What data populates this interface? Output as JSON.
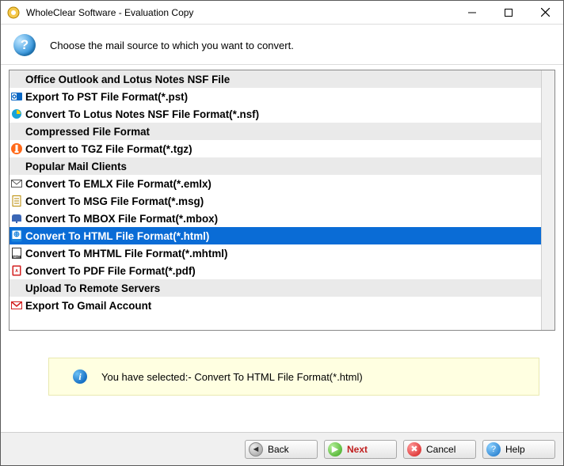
{
  "window": {
    "title": "WholeClear Software - Evaluation Copy"
  },
  "header": {
    "instruction": "Choose the mail source to which you want to convert."
  },
  "groups": [
    {
      "label": "Office Outlook and Lotus Notes NSF File"
    },
    {
      "label": "Compressed File Format"
    },
    {
      "label": "Popular Mail Clients"
    },
    {
      "label": "Upload To Remote Servers"
    }
  ],
  "items": {
    "pst": {
      "label": "Export To PST File Format(*.pst)"
    },
    "nsf": {
      "label": "Convert To Lotus Notes NSF File Format(*.nsf)"
    },
    "tgz": {
      "label": "Convert to TGZ File Format(*.tgz)"
    },
    "emlx": {
      "label": "Convert To EMLX File Format(*.emlx)"
    },
    "msg": {
      "label": "Convert To MSG File Format(*.msg)"
    },
    "mbox": {
      "label": "Convert To MBOX File Format(*.mbox)"
    },
    "html": {
      "label": "Convert To HTML File Format(*.html)"
    },
    "mhtml": {
      "label": "Convert To MHTML File Format(*.mhtml)"
    },
    "pdf": {
      "label": "Convert To PDF File Format(*.pdf)"
    },
    "gmail": {
      "label": "Export To Gmail Account"
    }
  },
  "selection_message": "You have selected:- Convert To HTML File Format(*.html)",
  "buttons": {
    "back": "Back",
    "next": "Next",
    "cancel": "Cancel",
    "help": "Help"
  }
}
